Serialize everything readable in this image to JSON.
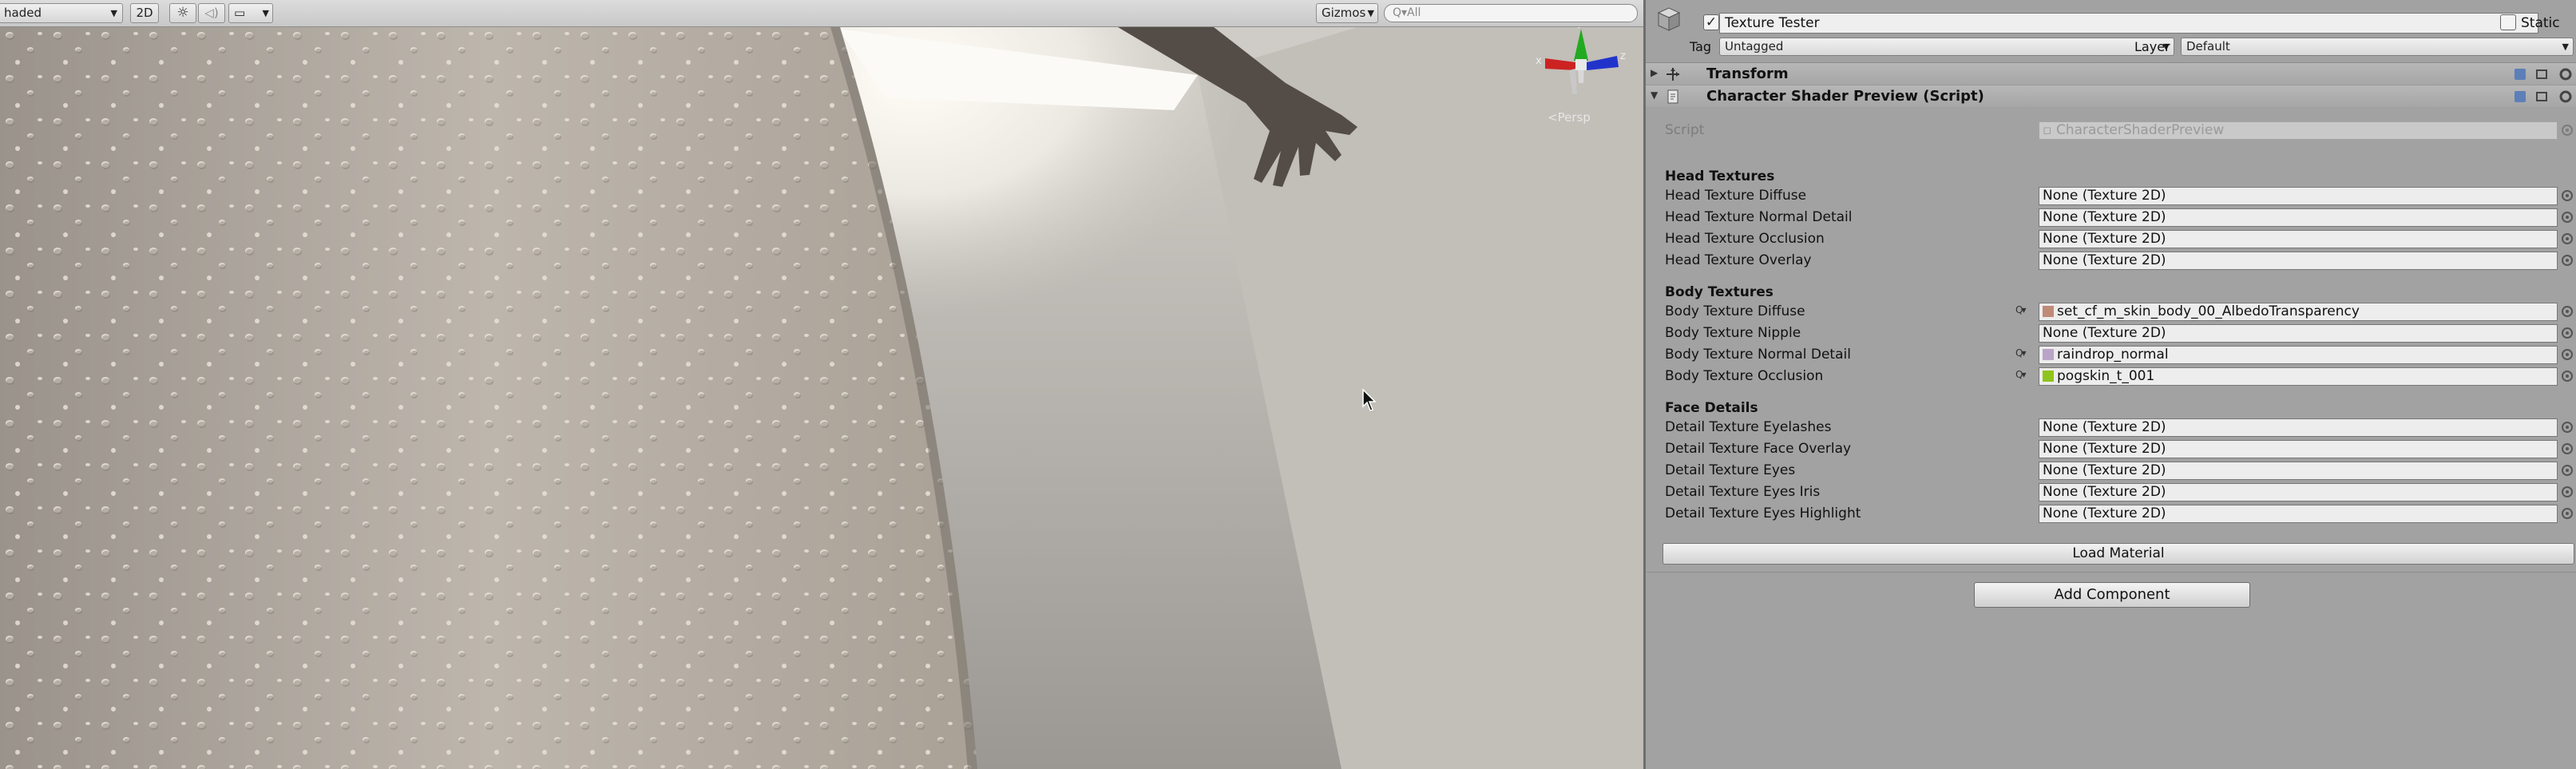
{
  "scene_toolbar": {
    "draw_mode": "haded",
    "mode_2d": "2D",
    "gizmos": "Gizmos",
    "search_placeholder": "Q▾All"
  },
  "scene": {
    "projection_label": "<Persp"
  },
  "inspector": {
    "object_name": "Texture Tester",
    "static_label": "Static",
    "tag_label": "Tag",
    "tag_value": "Untagged",
    "layer_label": "Layer",
    "layer_value": "Default",
    "components": [
      {
        "title": "Transform",
        "expanded": false
      },
      {
        "title": "Character Shader Preview (Script)",
        "expanded": true
      }
    ],
    "script_label": "Script",
    "script_value": "CharacterShaderPreview",
    "sections": [
      {
        "title": "Head Textures",
        "rows": [
          {
            "label": "Head Texture Diffuse",
            "value": "None (Texture 2D)"
          },
          {
            "label": "Head Texture Normal Detail",
            "value": "None (Texture 2D)"
          },
          {
            "label": "Head Texture Occlusion",
            "value": "None (Texture 2D)"
          },
          {
            "label": "Head Texture Overlay",
            "value": "None (Texture 2D)"
          }
        ]
      },
      {
        "title": "Body Textures",
        "rows": [
          {
            "label": "Body Texture Diffuse",
            "value": "set_cf_m_skin_body_00_AlbedoTransparency",
            "swatch": "#c08a78"
          },
          {
            "label": "Body Texture Nipple",
            "value": "None (Texture 2D)"
          },
          {
            "label": "Body Texture Normal Detail",
            "value": "raindrop_normal",
            "swatch": "#b9a4c8"
          },
          {
            "label": "Body Texture Occlusion",
            "value": "pogskin_t_001",
            "swatch": "#8fc41c"
          }
        ]
      },
      {
        "title": "Face Details",
        "rows": [
          {
            "label": "Detail Texture Eyelashes",
            "value": "None (Texture 2D)"
          },
          {
            "label": "Detail Texture Face Overlay",
            "value": "None (Texture 2D)"
          },
          {
            "label": "Detail Texture Eyes",
            "value": "None (Texture 2D)"
          },
          {
            "label": "Detail Texture Eyes Iris",
            "value": "None (Texture 2D)"
          },
          {
            "label": "Detail Texture Eyes Highlight",
            "value": "None (Texture 2D)"
          }
        ]
      }
    ],
    "load_material": "Load Material",
    "add_component": "Add Component"
  }
}
